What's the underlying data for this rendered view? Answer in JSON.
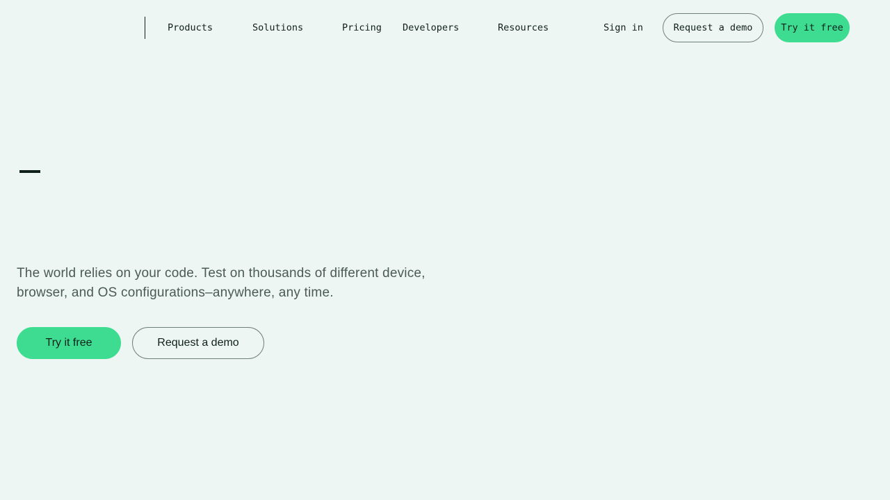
{
  "header": {
    "nav": {
      "products": "Products",
      "solutions": "Solutions",
      "pricing": "Pricing",
      "developers": "Developers",
      "resources": "Resources"
    },
    "sign_in": "Sign in",
    "request_demo": "Request a demo",
    "try_free": "Try it free"
  },
  "hero": {
    "heading_fragment": "–",
    "subtitle": "The world relies on your code. Test on thousands of different device, browser, and OS configurations–anywhere, any time.",
    "try_free": "Try it free",
    "request_demo": "Request a demo"
  },
  "colors": {
    "background": "#eef6f4",
    "accent_green": "#3ddc91",
    "text_dark": "#0f1f1a",
    "text_muted": "#4a5a55",
    "outline": "#6f7f7a"
  }
}
